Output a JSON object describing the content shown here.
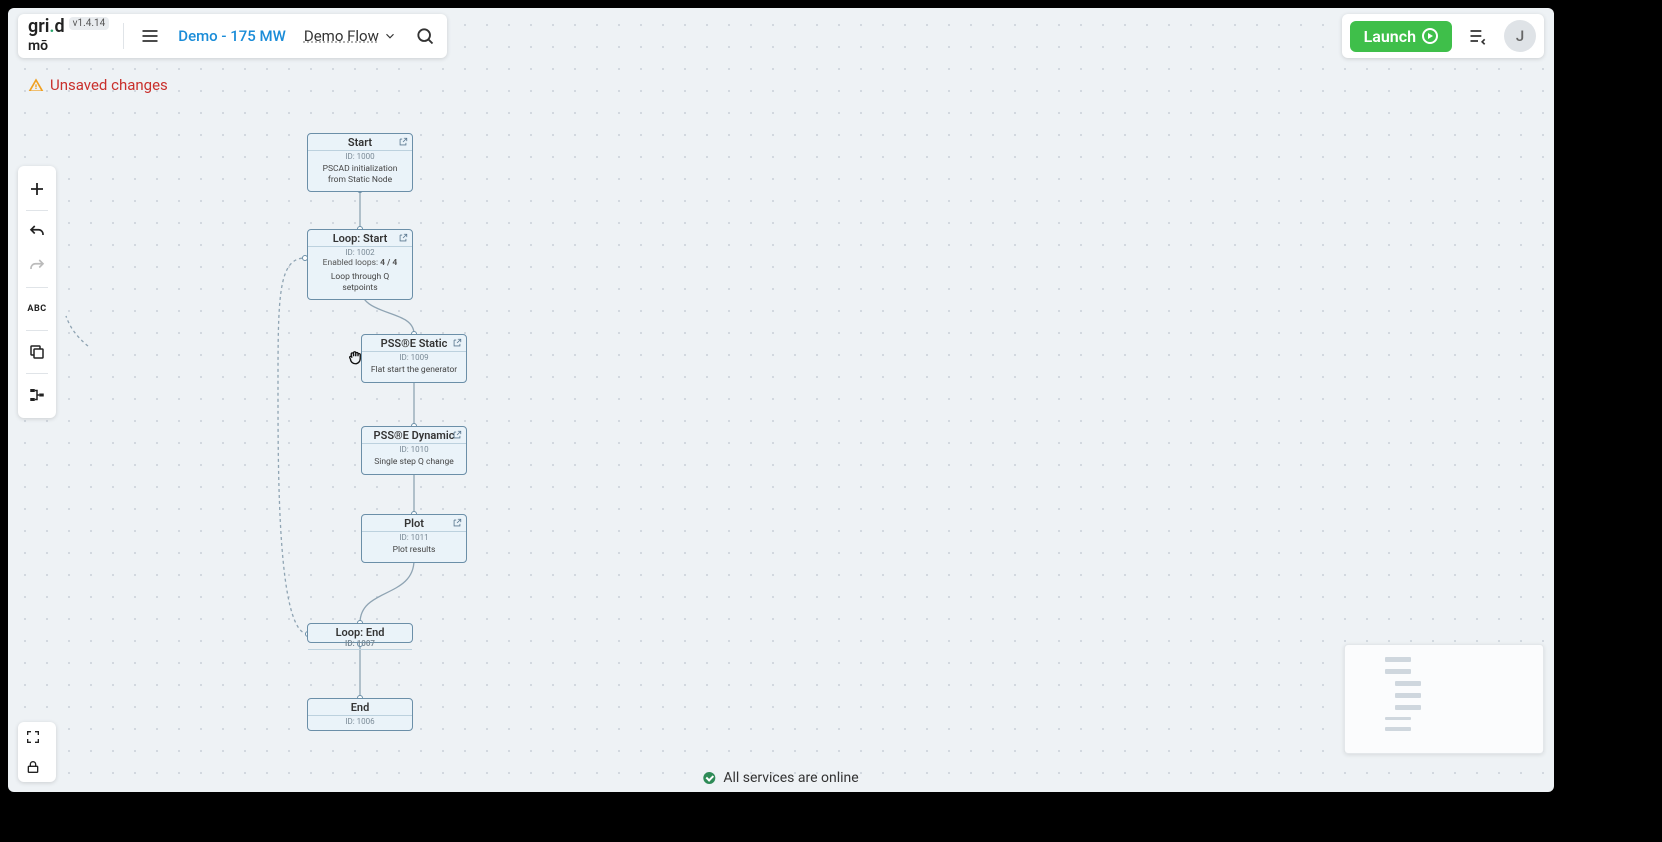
{
  "app": {
    "brand_left": "gri",
    "brand_right": "d",
    "brand_sub": "mō",
    "version": "v1.4.14"
  },
  "topbar": {
    "project": "Demo - 175 MW",
    "flow": "Demo Flow"
  },
  "unsaved_label": "Unsaved changes",
  "launch_label": "Launch",
  "avatar_initial": "J",
  "status_text": "All services are online",
  "left_tools": {
    "abc_label": "ABC"
  },
  "nodes": {
    "start": {
      "title": "Start",
      "id": "ID: 1000",
      "desc": "PSCAD initialization from Static Node"
    },
    "loop_start": {
      "title": "Loop: Start",
      "id": "ID: 1002",
      "meta_label": "Enabled loops:",
      "meta_value": "4 / 4",
      "desc": "Loop through Q setpoints"
    },
    "psse_static": {
      "title": "PSS®E Static",
      "id": "ID: 1009",
      "desc": "Flat start the generator"
    },
    "psse_dynamic": {
      "title": "PSS®E Dynamic",
      "id": "ID: 1010",
      "desc": "Single step Q change"
    },
    "plot": {
      "title": "Plot",
      "id": "ID: 1011",
      "desc": "Plot results"
    },
    "loop_end": {
      "title": "Loop: End",
      "id": "ID: 1007"
    },
    "end": {
      "title": "End",
      "id": "ID: 1006"
    }
  }
}
